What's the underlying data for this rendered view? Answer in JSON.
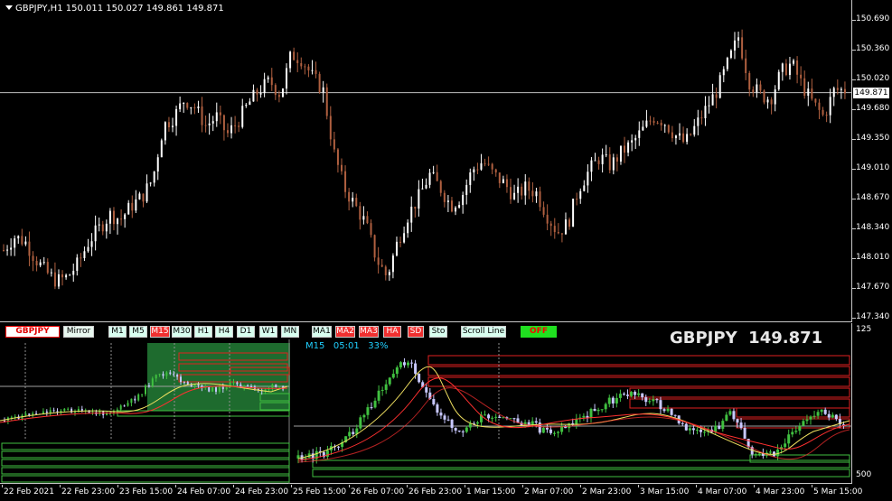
{
  "window": {
    "header": "GBPJPY,H1  150.011 150.027 149.861 149.871"
  },
  "price_axis": {
    "labels": [
      "150.690",
      "150.360",
      "150.020",
      "149.680",
      "149.350",
      "149.010",
      "148.670",
      "148.340",
      "148.010",
      "147.670",
      "147.340"
    ],
    "current_price": "149.871"
  },
  "sub_window": {
    "buttons": {
      "symbol": "GBPJPY",
      "mirror": "Mirror",
      "timeframes": [
        "M1",
        "M5",
        "M15",
        "M30",
        "H1",
        "H4",
        "D1",
        "W1",
        "MN"
      ],
      "active_timeframe": "M15",
      "indicators": [
        "MA1",
        "MA2",
        "MA3",
        "HA",
        "SD",
        "Sto"
      ],
      "scroll_line": "Scroll Line",
      "toggle": "OFF"
    },
    "info": {
      "timeframe": "M15",
      "countdown": "05:01",
      "percent": "33%"
    },
    "big_symbol": "GBPJPY",
    "big_price": "149.871",
    "ylabel_top": "125",
    "ylabel_bottom": "500"
  },
  "time_axis": {
    "labels": [
      "22 Feb 2021",
      "22 Feb 23:00",
      "23 Feb 15:00",
      "24 Feb 07:00",
      "24 Feb 23:00",
      "25 Feb 15:00",
      "26 Feb 07:00",
      "26 Feb 23:00",
      "1 Mar 15:00",
      "2 Mar 07:00",
      "2 Mar 23:00",
      "3 Mar 15:00",
      "4 Mar 07:00",
      "4 Mar 23:00",
      "5 Mar 15:00"
    ]
  },
  "colors": {
    "bull_main": "#ffffff",
    "bear_main": "#b06040",
    "bull_sub": "#40c040",
    "bear_sub": "#c8c8ff",
    "ma_yellow": "#f0e060",
    "ma_red": "#ff3030",
    "zone_red": "#e02020",
    "zone_green": "#40c040",
    "highlight": "#1e6b2e"
  },
  "chart_data": {
    "type": "candlestick",
    "symbol": "GBPJPY",
    "timeframe": "H1",
    "ylim": [
      147.2,
      150.8
    ],
    "close_path": [
      148.1,
      148.25,
      148.2,
      148.0,
      147.85,
      147.75,
      147.8,
      147.95,
      148.2,
      148.35,
      148.5,
      148.45,
      148.6,
      148.7,
      148.9,
      149.5,
      149.6,
      149.8,
      149.7,
      149.5,
      149.6,
      149.4,
      149.55,
      149.75,
      149.9,
      150.0,
      149.85,
      150.3,
      150.25,
      150.05,
      149.9,
      149.2,
      148.8,
      148.6,
      148.4,
      148.0,
      147.8,
      148.2,
      148.5,
      148.7,
      148.95,
      148.8,
      148.6,
      148.7,
      149.0,
      149.1,
      148.95,
      148.85,
      148.7,
      148.8,
      148.75,
      148.5,
      148.3,
      148.4,
      148.8,
      149.0,
      149.15,
      149.05,
      149.2,
      149.3,
      149.45,
      149.6,
      149.55,
      149.4,
      149.3,
      149.5,
      149.7,
      149.9,
      150.2,
      150.5,
      150.0,
      149.85,
      149.8,
      150.1,
      150.2,
      149.95,
      149.75,
      149.6,
      149.9,
      149.9
    ]
  }
}
